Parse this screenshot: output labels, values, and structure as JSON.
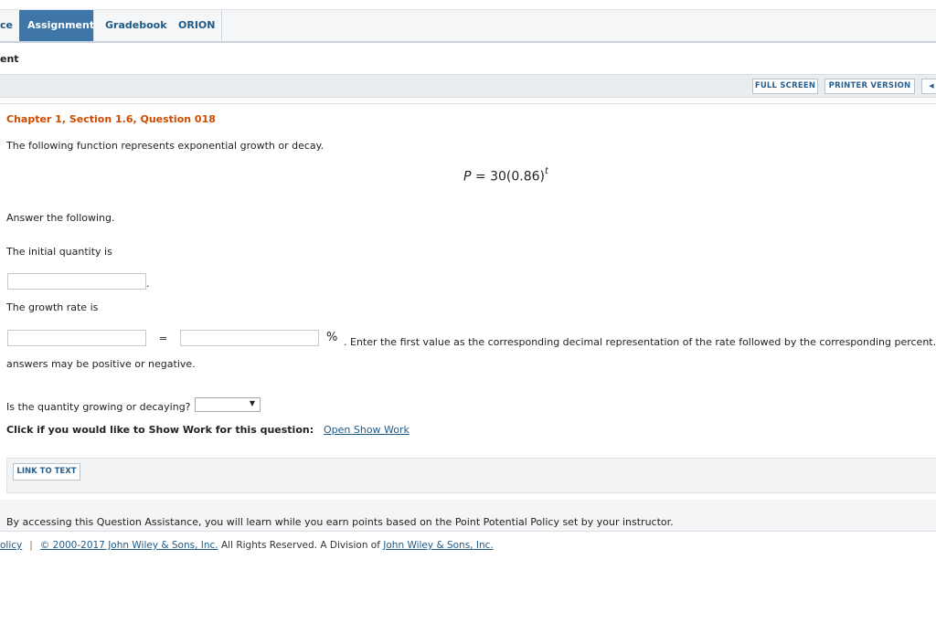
{
  "tabs": [
    {
      "label": "ce",
      "active": false
    },
    {
      "label": "Assignment",
      "active": true
    },
    {
      "label": "Gradebook",
      "active": false
    },
    {
      "label": "ORION",
      "active": false
    }
  ],
  "page_heading": "ent",
  "toolbar": {
    "full_screen": "FULL SCREEN",
    "printer_version": "PRINTER VERSION",
    "back_glyph": "◀"
  },
  "question": {
    "title": "Chapter 1, Section 1.6, Question 018",
    "intro": "The following function represents exponential growth or decay.",
    "formula": {
      "var": "P",
      "equals": "= 30(0.86)",
      "exponent": "t"
    },
    "answer_prompt": "Answer the following.",
    "initial_label": "The initial quantity is",
    "initial_period": ".",
    "growth_label": "The growth rate is",
    "equals_sign": "=",
    "percent_sign": "%",
    "growth_hint": ". Enter the first value as the corresponding decimal representation of the rate followed by the corresponding percent.",
    "sign_note": "answers may be positive or negative.",
    "growing_label": "Is the quantity growing or decaying?",
    "growing_select_value": "",
    "show_work_label": "Click if you would like to Show Work for this question:",
    "show_work_link": "Open Show Work"
  },
  "link_to_text": "LINK TO TEXT",
  "policy_text": "By accessing this Question Assistance, you will learn while you earn points based on the Point Potential Policy set by your instructor.",
  "footer": {
    "policy_link": "olicy",
    "separator": "|",
    "copyright_link": "© 2000-2017 John Wiley & Sons, Inc.",
    "rights_text": " All Rights Reserved. A Division of ",
    "company_link": "John Wiley & Sons, Inc."
  },
  "colors": {
    "accent_tab": "#3f76a8",
    "question_title": "#cc4b00",
    "link": "#1f5a87"
  }
}
